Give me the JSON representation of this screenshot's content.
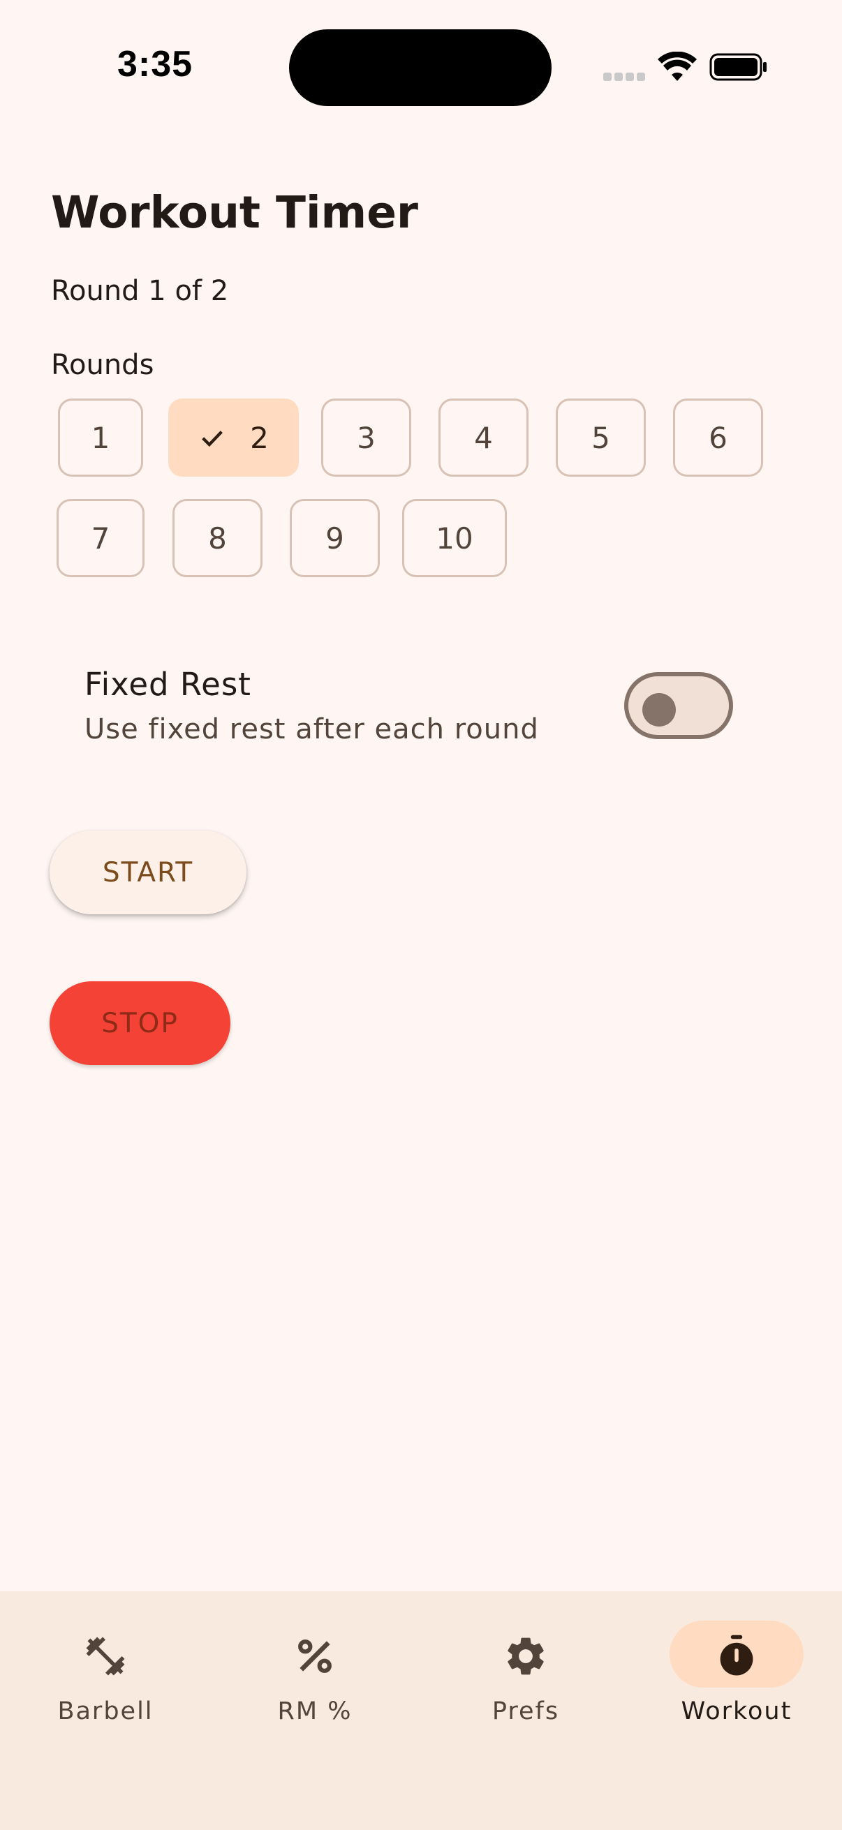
{
  "status_bar": {
    "time": "3:35"
  },
  "header": {
    "title": "Workout Timer",
    "round_status": "Round 1 of 2"
  },
  "rounds": {
    "label": "Rounds",
    "selected": "2",
    "options": [
      "1",
      "2",
      "3",
      "4",
      "5",
      "6",
      "7",
      "8",
      "9",
      "10"
    ]
  },
  "fixed_rest": {
    "title": "Fixed Rest",
    "subtitle": "Use fixed rest after each round",
    "enabled": false
  },
  "actions": {
    "start_label": "START",
    "stop_label": "STOP"
  },
  "bottom_nav": {
    "active": "Workout",
    "items": [
      {
        "label": "Barbell",
        "icon": "barbell-icon"
      },
      {
        "label": "RM %",
        "icon": "percent-icon"
      },
      {
        "label": "Prefs",
        "icon": "gear-icon"
      },
      {
        "label": "Workout",
        "icon": "stopwatch-icon"
      }
    ]
  },
  "colors": {
    "background": "#fff6f3",
    "selected_chip": "#ffdcc1",
    "stop_button": "#f44336",
    "nav_background": "#f9eae0"
  }
}
